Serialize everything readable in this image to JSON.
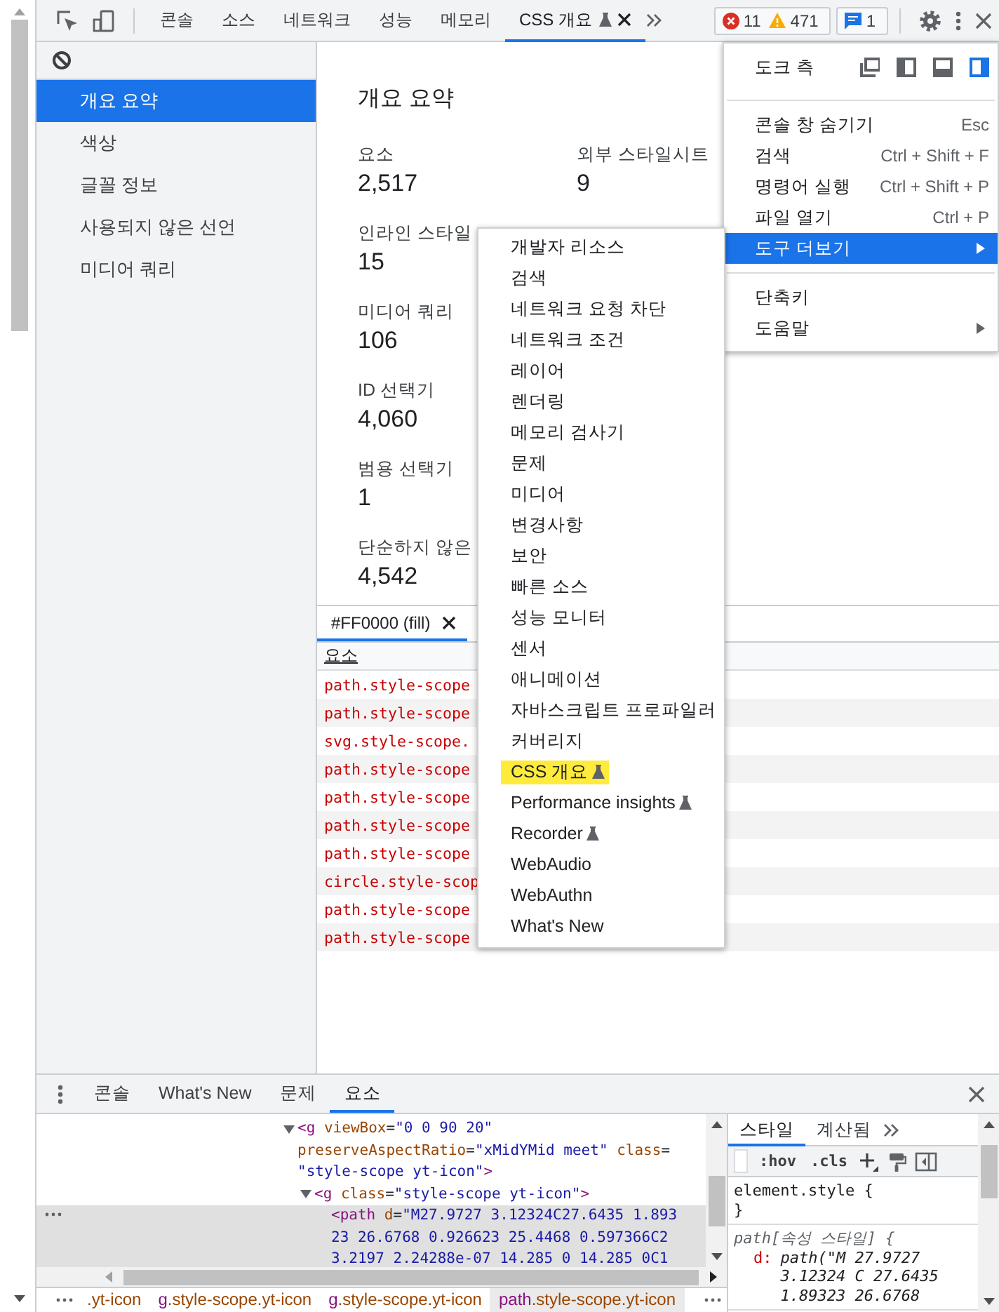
{
  "toolbar": {
    "tabs": [
      {
        "label": "콘솔",
        "selected": false,
        "experimental": false,
        "closable": false
      },
      {
        "label": "소스",
        "selected": false,
        "experimental": false,
        "closable": false
      },
      {
        "label": "네트워크",
        "selected": false,
        "experimental": false,
        "closable": false
      },
      {
        "label": "성능",
        "selected": false,
        "experimental": false,
        "closable": false
      },
      {
        "label": "메모리",
        "selected": false,
        "experimental": false,
        "closable": false
      },
      {
        "label": "CSS 개요",
        "selected": true,
        "experimental": true,
        "closable": true
      }
    ],
    "errors": "11",
    "warnings": "471",
    "messages": "1"
  },
  "sidebar": {
    "items": [
      {
        "label": "개요 요약",
        "selected": true
      },
      {
        "label": "색상",
        "selected": false
      },
      {
        "label": "글꼴 정보",
        "selected": false
      },
      {
        "label": "사용되지 않은 선언",
        "selected": false
      },
      {
        "label": "미디어 쿼리",
        "selected": false
      }
    ]
  },
  "overview": {
    "title": "개요 요약",
    "stat_rows": [
      {
        "cells": [
          {
            "label": "요소",
            "value": "2,517"
          },
          {
            "label": "외부 스타일시트",
            "value": "9"
          }
        ]
      },
      {
        "cells": [
          {
            "label": "인라인 스타일",
            "value": "15"
          }
        ]
      },
      {
        "cells": [
          {
            "label": "미디어 쿼리",
            "value": "106"
          }
        ]
      },
      {
        "cells": [
          {
            "label": "ID 선택기",
            "value": "4,060"
          }
        ]
      },
      {
        "cells": [
          {
            "label": "범용 선택기",
            "value": "1"
          }
        ]
      },
      {
        "cells": [
          {
            "label": "단순하지 않은",
            "value": "4,542"
          }
        ]
      }
    ]
  },
  "detail_tabs": [
    {
      "label": "#FF0000 (fill)",
      "selected": true,
      "closable": true
    }
  ],
  "table": {
    "columns": [
      "요소"
    ],
    "rows": [
      "path.style-scope",
      "path.style-scope",
      "svg.style-scope.",
      "path.style-scope",
      "path.style-scope",
      "path.style-scope",
      "path.style-scope",
      "circle.style-scop",
      "path.style-scope",
      "path.style-scope"
    ]
  },
  "main_menu": {
    "dock_label": "도크 측",
    "dock_options": [
      {
        "kind": "undock",
        "selected": false
      },
      {
        "kind": "left",
        "selected": false
      },
      {
        "kind": "bottom",
        "selected": false
      },
      {
        "kind": "right",
        "selected": true
      }
    ],
    "sections": [
      [
        {
          "label": "콘솔 창 숨기기",
          "shortcut": "Esc",
          "submenu": false,
          "selected": false
        },
        {
          "label": "검색",
          "shortcut": "Ctrl + Shift + F",
          "submenu": false,
          "selected": false
        },
        {
          "label": "명령어 실행",
          "shortcut": "Ctrl + Shift + P",
          "submenu": false,
          "selected": false
        },
        {
          "label": "파일 열기",
          "shortcut": "Ctrl + P",
          "submenu": false,
          "selected": false
        },
        {
          "label": "도구 더보기",
          "submenu": true,
          "selected": true
        }
      ],
      [
        {
          "label": "단축키",
          "submenu": false,
          "selected": false
        },
        {
          "label": "도움말",
          "submenu": true,
          "selected": false
        }
      ]
    ]
  },
  "tools_menu": {
    "items": [
      {
        "label": "개발자 리소스",
        "highlighted": false,
        "experimental": false
      },
      {
        "label": "검색",
        "highlighted": false,
        "experimental": false
      },
      {
        "label": "네트워크 요청 차단",
        "highlighted": false,
        "experimental": false
      },
      {
        "label": "네트워크 조건",
        "highlighted": false,
        "experimental": false
      },
      {
        "label": "레이어",
        "highlighted": false,
        "experimental": false
      },
      {
        "label": "렌더링",
        "highlighted": false,
        "experimental": false
      },
      {
        "label": "메모리 검사기",
        "highlighted": false,
        "experimental": false
      },
      {
        "label": "문제",
        "highlighted": false,
        "experimental": false
      },
      {
        "label": "미디어",
        "highlighted": false,
        "experimental": false
      },
      {
        "label": "변경사항",
        "highlighted": false,
        "experimental": false
      },
      {
        "label": "보안",
        "highlighted": false,
        "experimental": false
      },
      {
        "label": "빠른 소스",
        "highlighted": false,
        "experimental": false
      },
      {
        "label": "성능 모니터",
        "highlighted": false,
        "experimental": false
      },
      {
        "label": "센서",
        "highlighted": false,
        "experimental": false
      },
      {
        "label": "애니메이션",
        "highlighted": false,
        "experimental": false
      },
      {
        "label": "자바스크립트 프로파일러",
        "highlighted": false,
        "experimental": false
      },
      {
        "label": "커버리지",
        "highlighted": false,
        "experimental": false
      },
      {
        "label": "CSS 개요",
        "highlighted": true,
        "experimental": true
      },
      {
        "label": "Performance insights",
        "highlighted": false,
        "experimental": true
      },
      {
        "label": "Recorder",
        "highlighted": false,
        "experimental": true
      },
      {
        "label": "WebAudio",
        "highlighted": false,
        "experimental": false
      },
      {
        "label": "WebAuthn",
        "highlighted": false,
        "experimental": false
      },
      {
        "label": "What's New",
        "highlighted": false,
        "experimental": false
      }
    ]
  },
  "drawer": {
    "tabs": [
      {
        "label": "콘솔",
        "selected": false
      },
      {
        "label": "What's New",
        "selected": false
      },
      {
        "label": "문제",
        "selected": false
      },
      {
        "label": "요소",
        "selected": true
      }
    ],
    "tree": [
      {
        "expanded": true,
        "selected": false,
        "lines": [
          [
            {
              "kind": "tag",
              "text": "<g"
            },
            {
              "kind": "attr",
              "text": " viewBox"
            },
            {
              "kind": "punct",
              "text": "="
            },
            {
              "kind": "value",
              "text": "\"0 0 90 20\""
            }
          ],
          [
            {
              "kind": "attr",
              "text": "preserveAspectRatio"
            },
            {
              "kind": "punct",
              "text": "="
            },
            {
              "kind": "value",
              "text": "\"xMidYMid meet\""
            },
            {
              "kind": "attr",
              "text": " class"
            },
            {
              "kind": "punct",
              "text": "="
            }
          ],
          [
            {
              "kind": "value",
              "text": "\"style-scope yt-icon\""
            },
            {
              "kind": "tag",
              "text": ">"
            }
          ]
        ],
        "children": [
          {
            "expanded": true,
            "selected": false,
            "lines": [
              [
                {
                  "kind": "tag",
                  "text": "<g"
                },
                {
                  "kind": "attr",
                  "text": " class"
                },
                {
                  "kind": "punct",
                  "text": "="
                },
                {
                  "kind": "value",
                  "text": "\"style-scope yt-icon\""
                },
                {
                  "kind": "tag",
                  "text": ">"
                }
              ]
            ],
            "children": [
              {
                "selected": true,
                "lines": [
                  [
                    {
                      "kind": "tag",
                      "text": "<path"
                    },
                    {
                      "kind": "attr",
                      "text": " d"
                    },
                    {
                      "kind": "punct",
                      "text": "="
                    },
                    {
                      "kind": "value",
                      "text": "\"M27.9727 3.12324C27.6435 1.893"
                    }
                  ],
                  [
                    {
                      "kind": "value",
                      "text": "23 26.6768 0.926623 25.4468 0.597366C2"
                    }
                  ],
                  [
                    {
                      "kind": "value",
                      "text": "3.2197 2.24288e-07 14.285 0 14.285 0C1"
                    }
                  ]
                ]
              }
            ]
          }
        ]
      }
    ],
    "breadcrumbs": [
      {
        "classes": ".yt-icon",
        "selected": false
      },
      {
        "tag": "g",
        "classes": ".style-scope.yt-icon",
        "selected": false
      },
      {
        "tag": "g",
        "classes": ".style-scope.yt-icon",
        "selected": false
      },
      {
        "tag": "path",
        "classes": ".style-scope.yt-icon",
        "selected": true
      }
    ]
  },
  "styles_pane": {
    "tabs": [
      {
        "label": "스타일",
        "selected": true
      },
      {
        "label": "계산됨",
        "selected": false
      }
    ],
    "toggles": [
      ":hov",
      ".cls"
    ],
    "rules": [
      {
        "selector": "element.style {",
        "italic": false,
        "closing": "}"
      },
      {
        "selector": "path[속성 스타일] {",
        "italic": true,
        "declarations": [
          {
            "property": "d:",
            "value_lines": [
              "path(\"M 27.9727",
              "3.12324 C 27.6435",
              "1.89323 26.6768"
            ]
          }
        ]
      }
    ]
  }
}
